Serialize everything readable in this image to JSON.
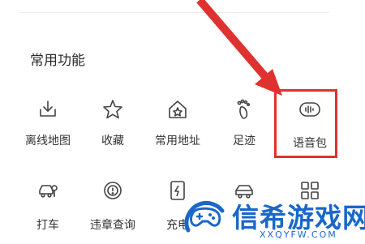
{
  "section": {
    "title": "常用功能"
  },
  "row1": [
    {
      "label": "离线地图",
      "icon": "offline-map-icon"
    },
    {
      "label": "收藏",
      "icon": "star-icon"
    },
    {
      "label": "常用地址",
      "icon": "home-star-icon"
    },
    {
      "label": "足迹",
      "icon": "footprint-icon"
    },
    {
      "label": "语音包",
      "icon": "voice-pack-icon"
    }
  ],
  "row2": [
    {
      "label": "打车",
      "icon": "taxi-icon"
    },
    {
      "label": "违章查询",
      "icon": "violation-query-icon"
    },
    {
      "label": "充电",
      "icon": "charging-icon"
    },
    {
      "label": "",
      "icon": "car-icon"
    },
    {
      "label": "",
      "icon": "grid-icon"
    }
  ],
  "watermark": {
    "text": "信希游戏网",
    "domain": "XXQYFW.COM"
  },
  "colors": {
    "highlight": "#e03131",
    "arrow": "#e03131",
    "watermark": "#1a67c9"
  }
}
